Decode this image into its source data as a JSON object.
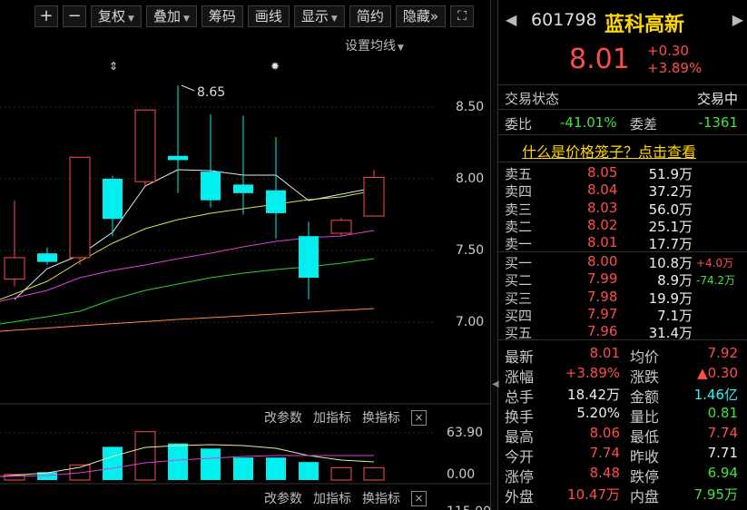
{
  "toolbar": {
    "plus": "+",
    "minus": "−",
    "fuquan": "复权",
    "diejia": "叠加",
    "chouma": "筹码",
    "huaxian": "画线",
    "xianshi": "显示",
    "jianyue": "简约",
    "yincang": "隐藏",
    "yincang_icon": "»",
    "expand_icon": "⛶"
  },
  "chart": {
    "set_ma_label": "设置均线",
    "price_axis": [
      "8.50",
      "8.00",
      "7.50",
      "7.00"
    ],
    "peak_label": "8.65",
    "volume_axis": [
      "63.90",
      "0.00"
    ],
    "partial_axis": "115.00",
    "ind_controls": {
      "gaicanshu": "改参数",
      "jiazhibiao": "加指标",
      "huanzhibiao": "换指标",
      "close": "×"
    },
    "markers": [
      "⇕",
      "✹"
    ]
  },
  "candles": [
    {
      "o": 7.45,
      "c": 7.3,
      "h": 7.85,
      "l": 7.25,
      "color": "red",
      "v": 10
    },
    {
      "o": 7.48,
      "c": 7.42,
      "h": 7.52,
      "l": 7.4,
      "color": "cyan",
      "v": 14
    },
    {
      "o": 7.45,
      "c": 8.15,
      "h": 8.15,
      "l": 7.4,
      "color": "red",
      "v": 27
    },
    {
      "o": 8.0,
      "c": 7.72,
      "h": 8.02,
      "l": 7.6,
      "color": "cyan",
      "v": 59
    },
    {
      "o": 7.98,
      "c": 8.48,
      "h": 8.48,
      "l": 7.95,
      "color": "red",
      "v": 86
    },
    {
      "o": 8.16,
      "c": 8.13,
      "h": 8.65,
      "l": 7.9,
      "color": "cyan",
      "v": 65
    },
    {
      "o": 8.05,
      "c": 7.85,
      "h": 8.45,
      "l": 7.8,
      "color": "cyan",
      "v": 56
    },
    {
      "o": 7.96,
      "c": 7.9,
      "h": 8.44,
      "l": 7.75,
      "color": "cyan",
      "v": 40
    },
    {
      "o": 7.92,
      "c": 7.76,
      "h": 8.29,
      "l": 7.58,
      "color": "cyan",
      "v": 40
    },
    {
      "o": 7.6,
      "c": 7.31,
      "h": 7.7,
      "l": 7.16,
      "color": "cyan",
      "v": 32
    },
    {
      "o": 7.62,
      "c": 7.71,
      "h": 7.73,
      "l": 7.6,
      "color": "red",
      "v": 22
    },
    {
      "o": 7.74,
      "c": 8.01,
      "h": 8.06,
      "l": 7.74,
      "color": "red",
      "v": 22
    }
  ],
  "stock": {
    "prev_icon": "◀",
    "next_icon": "▶",
    "code": "601798",
    "name": "蓝科高新",
    "price": "8.01",
    "change": "+0.30",
    "pct": "+3.89%"
  },
  "status": {
    "label": "交易状态",
    "value": "交易中",
    "weibi_label": "委比",
    "weibi": "-41.01%",
    "weicha_label": "委差",
    "weicha": "-1361"
  },
  "link": "什么是价格笼子？点击查看",
  "sell": [
    {
      "label": "卖五",
      "price": "8.05",
      "vol": "51.9万"
    },
    {
      "label": "卖四",
      "price": "8.04",
      "vol": "37.2万"
    },
    {
      "label": "卖三",
      "price": "8.03",
      "vol": "56.0万"
    },
    {
      "label": "卖二",
      "price": "8.02",
      "vol": "25.1万"
    },
    {
      "label": "卖一",
      "price": "8.01",
      "vol": "17.7万"
    }
  ],
  "buy": [
    {
      "label": "买一",
      "price": "8.00",
      "vol": "10.8万",
      "delta": "+4.0万"
    },
    {
      "label": "买二",
      "price": "7.99",
      "vol": "8.9万",
      "delta": "-74.2万"
    },
    {
      "label": "买三",
      "price": "7.98",
      "vol": "19.9万",
      "delta": ""
    },
    {
      "label": "买四",
      "price": "7.97",
      "vol": "7.1万",
      "delta": ""
    },
    {
      "label": "买五",
      "price": "7.96",
      "vol": "31.4万",
      "delta": ""
    }
  ],
  "stats": [
    {
      "l1": "最新",
      "v1": "8.01",
      "c1": "red",
      "l2": "均价",
      "v2": "7.92",
      "c2": "red"
    },
    {
      "l1": "涨幅",
      "v1": "+3.89%",
      "c1": "red",
      "l2": "涨跌",
      "v2": "▲0.30",
      "c2": "red"
    },
    {
      "l1": "总手",
      "v1": "18.42万",
      "c1": "white",
      "l2": "金额",
      "v2": "1.46亿",
      "c2": "cyan"
    },
    {
      "l1": "换手",
      "v1": "5.20%",
      "c1": "white",
      "l2": "量比",
      "v2": "0.81",
      "c2": "green"
    },
    {
      "l1": "最高",
      "v1": "8.06",
      "c1": "red",
      "l2": "最低",
      "v2": "7.74",
      "c2": "red"
    },
    {
      "l1": "今开",
      "v1": "7.74",
      "c1": "red",
      "l2": "昨收",
      "v2": "7.71",
      "c2": "white"
    },
    {
      "l1": "涨停",
      "v1": "8.48",
      "c1": "red",
      "l2": "跌停",
      "v2": "6.94",
      "c2": "green"
    },
    {
      "l1": "外盘",
      "v1": "10.47万",
      "c1": "red",
      "l2": "内盘",
      "v2": "7.95万",
      "c2": "green"
    }
  ],
  "colors": {
    "red": "#ff4d4d",
    "cyan": "#00f0f0",
    "green": "#3fe33f",
    "gold": "#ffd700"
  }
}
